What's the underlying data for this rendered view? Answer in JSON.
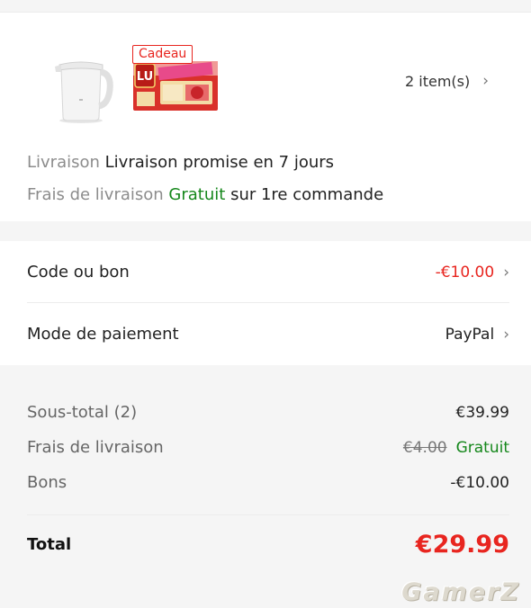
{
  "order_items": {
    "gift_tag": "Cadeau",
    "items_count": "2 item(s)",
    "chevron": "›"
  },
  "delivery": {
    "label": "Livraison",
    "value": "Livraison promise en 7 jours"
  },
  "shipping_fee": {
    "label": "Frais de livraison",
    "free_text": "Gratuit",
    "note": "sur 1re commande"
  },
  "code_row": {
    "label": "Code ou bon",
    "value": "-€10.00"
  },
  "payment_row": {
    "label": "Mode de paiement",
    "value": "PayPal"
  },
  "summary": {
    "subtotal_label": "Sous-total (2)",
    "subtotal_value": "€39.99",
    "shipping_label": "Frais de livraison",
    "shipping_old": "€4.00",
    "shipping_new": "Gratuit",
    "vouchers_label": "Bons",
    "vouchers_value": "-€10.00",
    "total_label": "Total",
    "total_value": "€29.99"
  },
  "watermark": "GamerZ",
  "colors": {
    "accent_red": "#e8251f",
    "green": "#15871b"
  },
  "icons": [
    "kettle-product-image",
    "biscuit-product-image",
    "chevron-right-icon"
  ]
}
